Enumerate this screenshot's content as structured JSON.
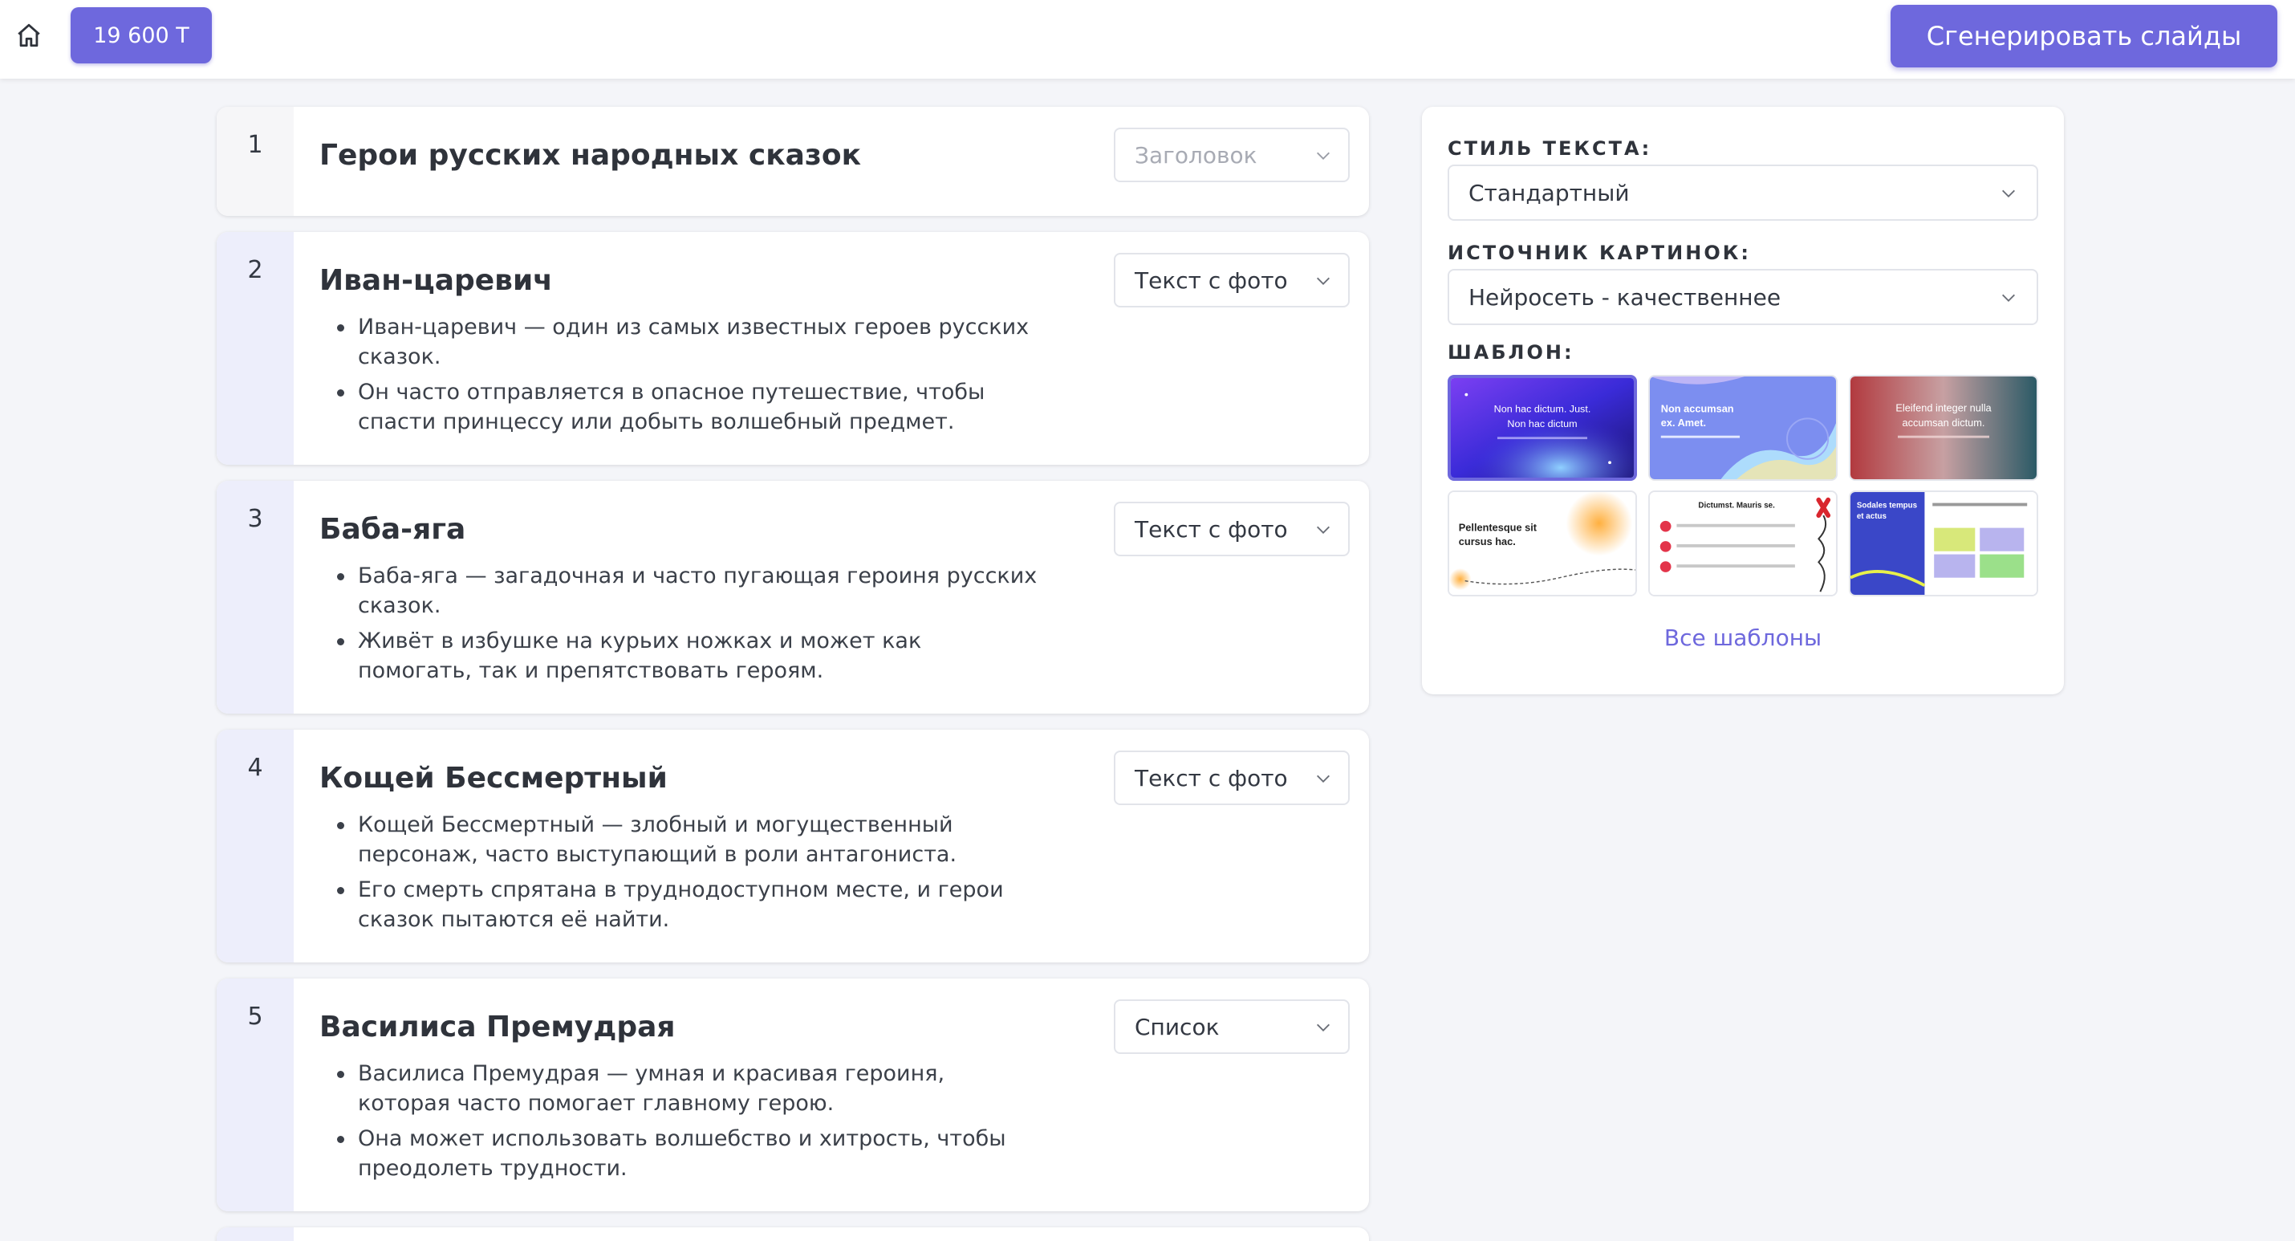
{
  "topbar": {
    "balance": "19 600 Т",
    "generate_label": "Сгенерировать слайды"
  },
  "slides": [
    {
      "number": "1",
      "title": "Герои русских народных сказок",
      "type": "Заголовок",
      "bullets": []
    },
    {
      "number": "2",
      "title": "Иван-царевич",
      "type": "Текст с фото",
      "bullets": [
        "Иван-царевич — один из самых известных героев русских сказок.",
        "Он часто отправляется в опасное путешествие, чтобы спасти принцессу или добыть волшебный предмет."
      ]
    },
    {
      "number": "3",
      "title": "Баба-яга",
      "type": "Текст с фото",
      "bullets": [
        "Баба-яга — загадочная и часто пугающая героиня русских сказок.",
        "Живёт в избушке на курьих ножках и может как помогать, так и препятствовать героям."
      ]
    },
    {
      "number": "4",
      "title": "Кощей Бессмертный",
      "type": "Текст с фото",
      "bullets": [
        "Кощей Бессмертный — злобный и могущественный персонаж, часто выступающий в роли антагониста.",
        "Его смерть спрятана в труднодоступном месте, и герои сказок пытаются её найти."
      ]
    },
    {
      "number": "5",
      "title": "Василиса Премудрая",
      "type": "Список",
      "bullets": [
        "Василиса Премудрая — умная и красивая героиня, которая часто помогает главному герою.",
        "Она может использовать волшебство и хитрость, чтобы преодолеть трудности."
      ]
    }
  ],
  "settings": {
    "text_style_label": "СТИЛЬ ТЕКСТА:",
    "text_style_value": "Стандартный",
    "image_source_label": "ИСТОЧНИК КАРТИНОК:",
    "image_source_value": "Нейросеть - качественнее",
    "template_label": "ШАБЛОН:",
    "all_templates_label": "Все шаблоны",
    "templates": [
      {
        "line1": "Non hac dictum. Just.",
        "line2": "Non hac dictum"
      },
      {
        "line1": "Non accumsan",
        "line2": "ex. Amet."
      },
      {
        "line1": "Eleifend integer nulla",
        "line2": "accumsan dictum."
      },
      {
        "line1": "Pellentesque sit",
        "line2": "cursus hac."
      },
      {
        "line1": "Dictumst. Mauris se.",
        "line2": ""
      },
      {
        "line1": "Sodales tempus",
        "line2": "et actus"
      }
    ]
  },
  "colors": {
    "accent": "#6e68dd",
    "number_column": "#edeefb",
    "background": "#f4f5f9"
  }
}
